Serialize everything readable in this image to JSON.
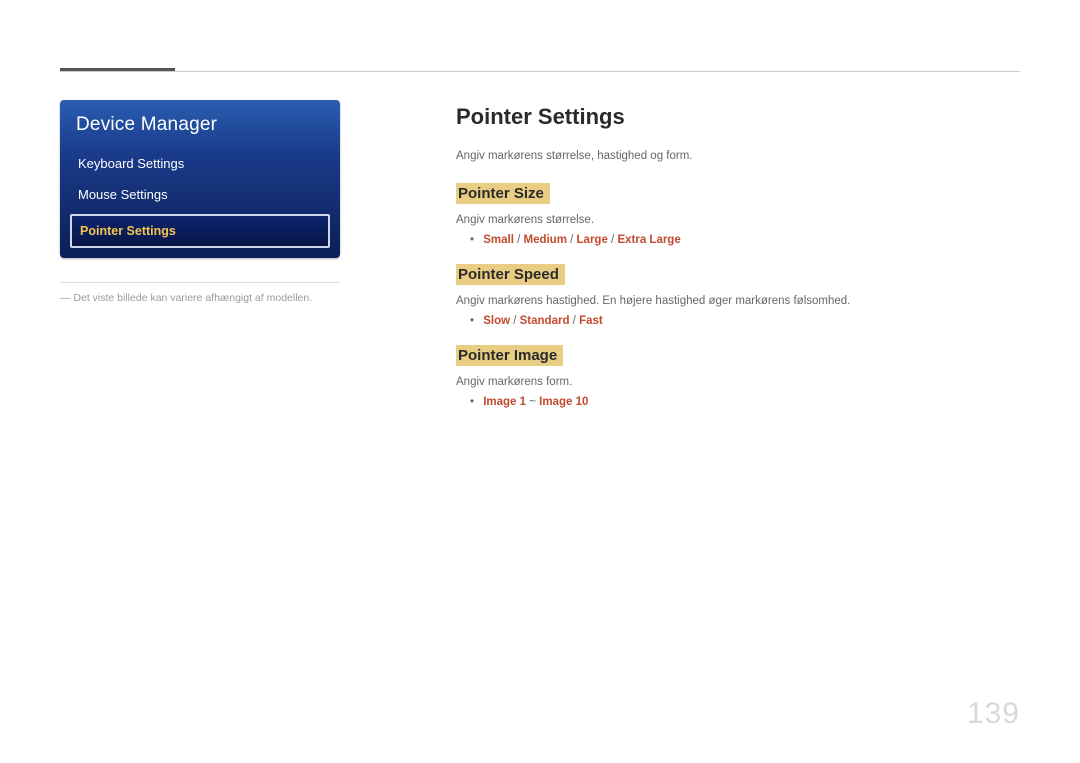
{
  "panel": {
    "title": "Device Manager",
    "items": [
      {
        "label": "Keyboard Settings",
        "selected": false
      },
      {
        "label": "Mouse Settings",
        "selected": false
      },
      {
        "label": "Pointer Settings",
        "selected": true
      }
    ]
  },
  "caption": "― Det viste billede kan variere afhængigt af modellen.",
  "main": {
    "title": "Pointer Settings",
    "intro": "Angiv markørens størrelse, hastighed og form.",
    "sections": [
      {
        "heading": "Pointer Size",
        "desc": "Angiv markørens størrelse.",
        "options": [
          "Small",
          "Medium",
          "Large",
          "Extra Large"
        ],
        "sep": " / "
      },
      {
        "heading": "Pointer Speed",
        "desc": "Angiv markørens hastighed. En højere hastighed øger markørens følsomhed.",
        "options": [
          "Slow",
          "Standard",
          "Fast"
        ],
        "sep": " / "
      },
      {
        "heading": "Pointer Image",
        "desc": "Angiv markørens form.",
        "options": [
          "Image 1",
          "Image 10"
        ],
        "sep": " ~ "
      }
    ]
  },
  "page_number": "139"
}
